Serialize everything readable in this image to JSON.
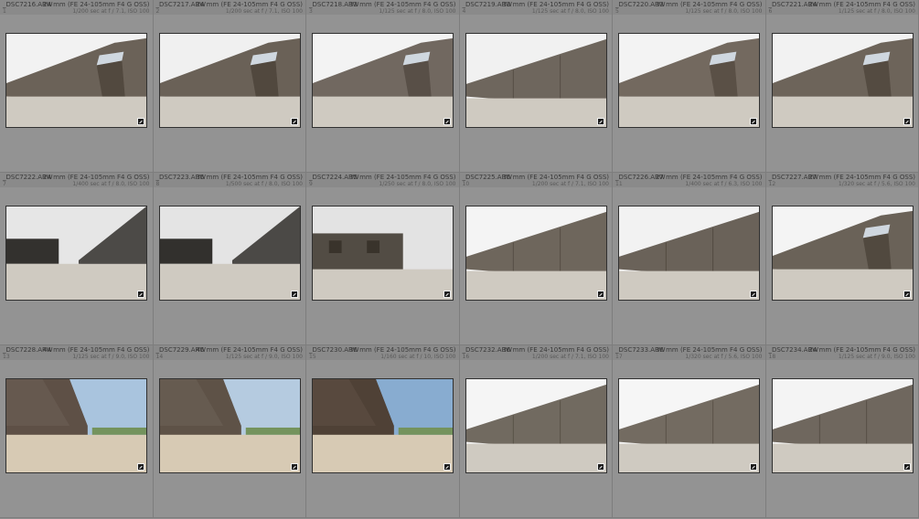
{
  "photos": [
    {
      "file": "_DSC7216.ARW",
      "lens": "24 mm (FE 24-105mm F4 G OSS)",
      "index": "1",
      "exposure": "1/200 sec at f / 7.1, ISO 100",
      "scene": "wall-door",
      "sky": "#f2f2f2",
      "tone": "#6b6258"
    },
    {
      "file": "_DSC7217.ARW",
      "lens": "24 mm (FE 24-105mm F4 G OSS)",
      "index": "2",
      "exposure": "1/200 sec at f / 7.1, ISO 100",
      "scene": "wall-door",
      "sky": "#f0f0f0",
      "tone": "#6a6157"
    },
    {
      "file": "_DSC7218.ARW",
      "lens": "33 mm (FE 24-105mm F4 G OSS)",
      "index": "3",
      "exposure": "1/125 sec at f / 8.0, ISO 100",
      "scene": "wall-door-close",
      "sky": "#f3f3f3",
      "tone": "#716860"
    },
    {
      "file": "_DSC7219.ARW",
      "lens": "33 mm (FE 24-105mm F4 G OSS)",
      "index": "4",
      "exposure": "1/125 sec at f / 8.0, ISO 100",
      "scene": "wall-long",
      "sky": "#f1f1f1",
      "tone": "#6e665d"
    },
    {
      "file": "_DSC7220.ARW",
      "lens": "33 mm (FE 24-105mm F4 G OSS)",
      "index": "5",
      "exposure": "1/125 sec at f / 8.0, ISO 100",
      "scene": "wall-door-close",
      "sky": "#f3f3f3",
      "tone": "#73695f"
    },
    {
      "file": "_DSC7221.ARW",
      "lens": "24 mm (FE 24-105mm F4 G OSS)",
      "index": "6",
      "exposure": "1/125 sec at f / 8.0, ISO 100",
      "scene": "wall-door",
      "sky": "#f2f2f2",
      "tone": "#6d645a"
    },
    {
      "file": "_DSC7222.ARW",
      "lens": "24 mm (FE 24-105mm F4 G OSS)",
      "index": "7",
      "exposure": "1/400 sec at f / 8.0, ISO 100",
      "scene": "building-right-wall",
      "sky": "#e6e6e6",
      "tone": "#4c4a47"
    },
    {
      "file": "_DSC7223.ARW",
      "lens": "35 mm (FE 24-105mm F4 G OSS)",
      "index": "8",
      "exposure": "1/500 sec at f / 8.0, ISO 100",
      "scene": "building-right-wall",
      "sky": "#e4e4e4",
      "tone": "#4b4946"
    },
    {
      "file": "_DSC7224.ARW",
      "lens": "35 mm (FE 24-105mm F4 G OSS)",
      "index": "9",
      "exposure": "1/250 sec at f / 8.0, ISO 100",
      "scene": "building-big",
      "sky": "#e3e3e3",
      "tone": "#524c44"
    },
    {
      "file": "_DSC7225.ARW",
      "lens": "35 mm (FE 24-105mm F4 G OSS)",
      "index": "10",
      "exposure": "1/200 sec at f / 7.1, ISO 100",
      "scene": "wall-long",
      "sky": "#f4f4f4",
      "tone": "#6e665c"
    },
    {
      "file": "_DSC7226.ARW",
      "lens": "27 mm (FE 24-105mm F4 G OSS)",
      "index": "11",
      "exposure": "1/400 sec at f / 6.3, ISO 100",
      "scene": "wall-long",
      "sky": "#f2f2f2",
      "tone": "#6a6259"
    },
    {
      "file": "_DSC7227.ARW",
      "lens": "27 mm (FE 24-105mm F4 G OSS)",
      "index": "12",
      "exposure": "1/320 sec at f / 5.6, ISO 100",
      "scene": "wall-door",
      "sky": "#f4f4f4",
      "tone": "#6a6258"
    },
    {
      "file": "_DSC7228.ARW",
      "lens": "44 mm (FE 24-105mm F4 G OSS)",
      "index": "13",
      "exposure": "1/125 sec at f / 9.0, ISO 100",
      "scene": "wedge-blue",
      "sky": "#a9c4de",
      "tone": "#5e5046"
    },
    {
      "file": "_DSC7229.ARW",
      "lens": "45 mm (FE 24-105mm F4 G OSS)",
      "index": "14",
      "exposure": "1/125 sec at f / 9.0, ISO 100",
      "scene": "wedge-blue",
      "sky": "#b5cbe0",
      "tone": "#5e5247"
    },
    {
      "file": "_DSC7230.ARW",
      "lens": "36 mm (FE 24-105mm F4 G OSS)",
      "index": "15",
      "exposure": "1/160 sec at f / 10, ISO 100",
      "scene": "wedge-blue-dark",
      "sky": "#88acd0",
      "tone": "#4f4136"
    },
    {
      "file": "_DSC7232.ARW",
      "lens": "36 mm (FE 24-105mm F4 G OSS)",
      "index": "16",
      "exposure": "1/200 sec at f / 7.1, ISO 100",
      "scene": "wall-long",
      "sky": "#f5f5f5",
      "tone": "#716a60"
    },
    {
      "file": "_DSC7233.ARW",
      "lens": "36 mm (FE 24-105mm F4 G OSS)",
      "index": "17",
      "exposure": "1/320 sec at f / 5.6, ISO 100",
      "scene": "wall-long",
      "sky": "#f6f6f6",
      "tone": "#736b61"
    },
    {
      "file": "_DSC7234.ARW",
      "lens": "24 mm (FE 24-105mm F4 G OSS)",
      "index": "18",
      "exposure": "1/125 sec at f / 9.0, ISO 100",
      "scene": "wall-long",
      "sky": "#f4f4f4",
      "tone": "#6f675e"
    }
  ],
  "colors": {
    "panel": "#939393",
    "header": "#8a8a8a",
    "text": "#2e2e2e"
  },
  "icons": {
    "edit_badge": "edit-badge-icon"
  }
}
